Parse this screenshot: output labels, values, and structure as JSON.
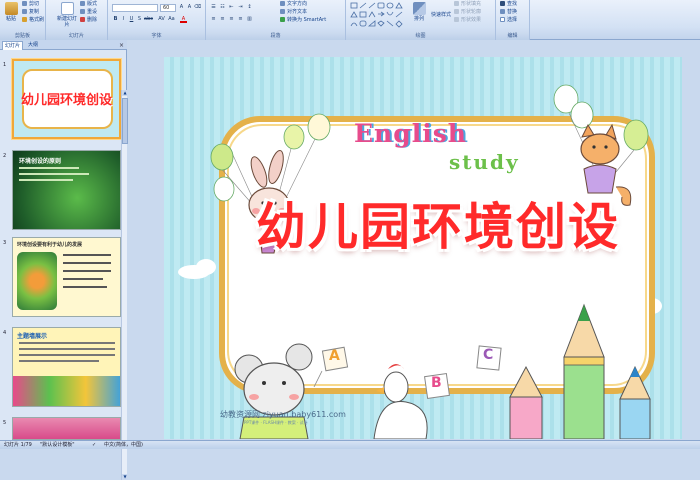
{
  "ribbon": {
    "clipboard": {
      "paste": "粘贴",
      "cut": "剪切",
      "copy": "复制",
      "format_painter": "格式刷",
      "group": "剪贴板"
    },
    "slides": {
      "new_slide": "新建幻灯片",
      "layout": "版式",
      "reset": "重设",
      "delete": "删除",
      "group": "幻灯片"
    },
    "font": {
      "font_name": "",
      "font_size": "60",
      "group": "字体"
    },
    "paragraph": {
      "text_direction": "文字方向",
      "align_text": "对齐文本",
      "smartart": "转换为 SmartArt",
      "group": "段落"
    },
    "drawing": {
      "arrange": "排列",
      "quick_styles": "快速样式",
      "shape_fill": "形状填充",
      "shape_outline": "形状轮廓",
      "shape_effects": "形状效果",
      "group": "绘图"
    },
    "editing": {
      "find": "查找",
      "replace": "替换",
      "select": "选择",
      "group": "编辑"
    }
  },
  "panel": {
    "tab_slides": "幻灯片",
    "tab_outline": "大纲",
    "close": "×",
    "thumbnails": [
      {
        "num": "1",
        "title": "幼儿园环境创设"
      },
      {
        "num": "2",
        "title": "环境创设的原则"
      },
      {
        "num": "3",
        "title": "环境创设要有利于幼儿的发展"
      },
      {
        "num": "4",
        "title": "主题墙展示"
      },
      {
        "num": "5",
        "title": ""
      }
    ]
  },
  "slide": {
    "english": "English",
    "study": "study",
    "title": "幼儿园环境创设",
    "letter_a": "A",
    "letter_b": "B",
    "letter_c": "C",
    "watermark": "幼教资源网 ziyuan.baby611.com",
    "watermark_sub": "PPT课件 · FLASH课件 · 教案 · 试卷"
  },
  "status": {
    "slide_pos": "幻灯片 1/79",
    "theme": "\"默认设计模板\"",
    "language": "中文(简体，中国)"
  },
  "colors": {
    "title_red": "#ff2a2a",
    "accent_orange": "#f0a83a",
    "ribbon_text": "#15428b"
  }
}
